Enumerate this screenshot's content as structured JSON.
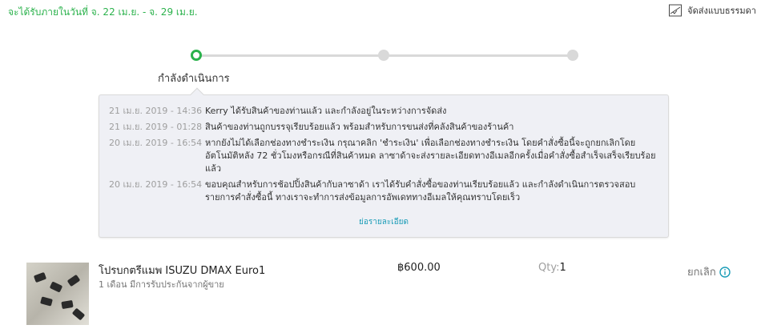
{
  "header": {
    "delivery_estimate": "จะได้รับภายในวันที่ จ. 22 เม.ย. - จ. 29 เม.ย.",
    "shipping_method": "จัดส่งแบบธรรมดา",
    "shipping_icon": "truck-icon"
  },
  "tracker": {
    "steps": 3,
    "current_step": 1,
    "status_label": "กำลังดำเนินการ"
  },
  "history": {
    "entries": [
      {
        "time": "21 เม.ย. 2019 - 14:36",
        "text": "Kerry ได้รับสินค้าของท่านแล้ว และกำลังอยู่ในระหว่างการจัดส่ง"
      },
      {
        "time": "21 เม.ย. 2019 - 01:28",
        "text": "สินค้าของท่านถูกบรรจุเรียบร้อยแล้ว พร้อมสำหรับการขนส่งที่คลังสินค้าของร้านค้า"
      },
      {
        "time": "20 เม.ย. 2019 - 16:54",
        "text": "หากยังไม่ได้เลือกช่องทางชำระเงิน กรุณาคลิก 'ชำระเงิน' เพื่อเลือกช่องทางชำระเงิน โดยคำสั่งซื้อนี้จะถูกยกเลิกโดยอัตโนมัติหลัง 72 ชั่วโมงหรือกรณีที่สินค้าหมด ลาซาด้าจะส่งรายละเอียดทางอีเมลอีกครั้งเมื่อคำสั่งซื้อสำเร็จเสร็จเรียบร้อยแล้ว"
      },
      {
        "time": "20 เม.ย. 2019 - 16:54",
        "text": "ขอบคุณสำหรับการช้อปปิ้งสินค้ากับลาซาด้า เราได้รับคำสั่งซื้อของท่านเรียบร้อยแล้ว และกำลังดำเนินการตรวจสอบรายการคำสั่งซื้อนี้ ทางเราจะทำการส่งข้อมูลการอัพเดททางอีเมลให้คุณทราบโดยเร็ว"
      }
    ],
    "collapse_link": "ย่อรายละเอียด"
  },
  "product": {
    "title": "โปรบกตรีแมพ ISUZU DMAX Euro1",
    "warranty": "1 เดือน มีการรับประกันจากผู้ขาย",
    "price": "฿600.00",
    "qty_label": "Qty:",
    "qty_value": "1",
    "cancel_label": "ยกเลิก",
    "cancel_icon": "info-icon"
  },
  "colors": {
    "accent_green": "#2bb24c",
    "link_blue": "#1a9cb7",
    "info_blue": "#1a9cb7"
  }
}
